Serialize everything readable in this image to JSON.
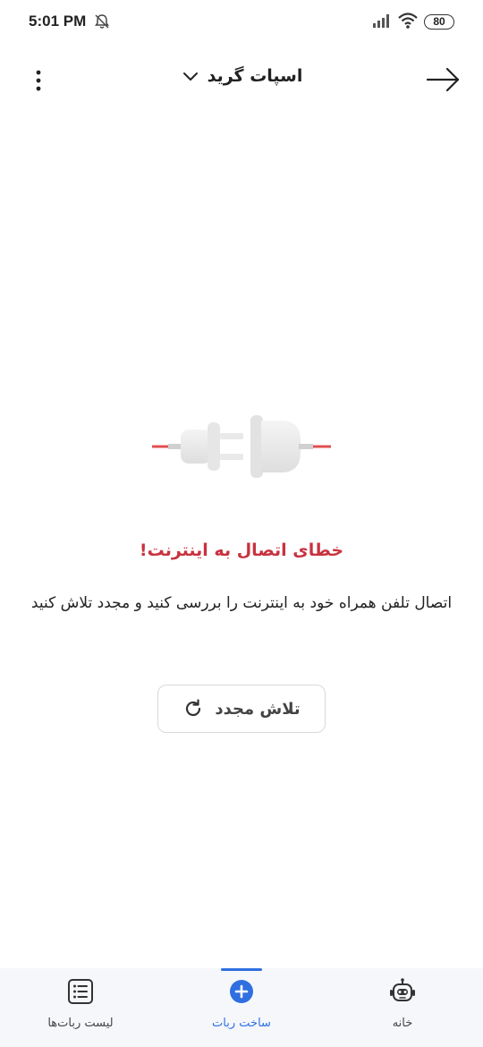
{
  "status_bar": {
    "time": "5:01 PM",
    "battery": "80"
  },
  "header": {
    "title": "اسپات گرید",
    "icons": [
      "menu-icon",
      "chevron-down-icon",
      "arrow-right-icon"
    ]
  },
  "error": {
    "title": "خطای اتصال به اینترنت!",
    "description": "اتصال تلفن همراه خود به اینترنت را بررسی کنید و مجدد تلاش کنید",
    "retry_label": "تلاش مجدد"
  },
  "bottom_nav": {
    "items": [
      {
        "label": "لیست ربات‌ها",
        "icon": "list-icon",
        "active": false
      },
      {
        "label": "ساخت ربات",
        "icon": "plus-circle-icon",
        "active": true
      },
      {
        "label": "خانه",
        "icon": "robot-icon",
        "active": false
      }
    ]
  },
  "colors": {
    "accent": "#2f6fe0",
    "error": "#c8323f"
  }
}
